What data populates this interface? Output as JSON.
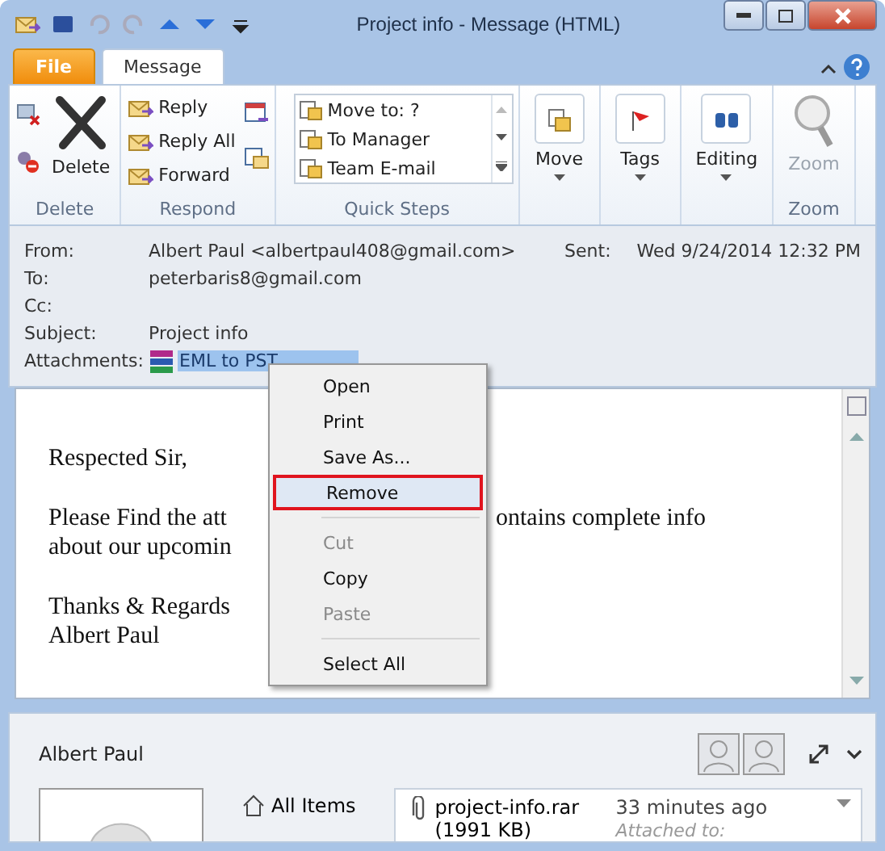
{
  "window": {
    "title": "Project info  -  Message (HTML)"
  },
  "tabs": [
    {
      "label": "File",
      "kind": "file",
      "selected": false
    },
    {
      "label": "Message",
      "kind": "tab",
      "selected": true
    }
  ],
  "ribbon": {
    "groups": [
      {
        "label": "Delete",
        "kind": "delete",
        "big": "Delete"
      },
      {
        "label": "Respond",
        "kind": "respond",
        "items": [
          "Reply",
          "Reply All",
          "Forward"
        ]
      },
      {
        "label": "Quick Steps",
        "kind": "quick",
        "items": [
          "Move to: ?",
          "To Manager",
          "Team E-mail"
        ]
      },
      {
        "kind": "move",
        "big": "Move",
        "disabled": false
      },
      {
        "kind": "tags",
        "big": "Tags",
        "disabled": false
      },
      {
        "kind": "editing",
        "big": "Editing",
        "disabled": false
      },
      {
        "label": "Zoom",
        "kind": "zoom",
        "big": "Zoom",
        "disabled": true
      }
    ]
  },
  "header": {
    "fields": [
      {
        "label": "From:",
        "value": "Albert Paul <albertpaul408@gmail.com>"
      },
      {
        "label": "To:",
        "value": "peterbaris8@gmail.com"
      },
      {
        "label": "Cc:"
      },
      {
        "label": "Subject:",
        "value": "Project info"
      }
    ],
    "sent": {
      "label": "Sent:",
      "value": "Wed 9/24/2014 12:32 PM"
    },
    "attachments": {
      "label": "Attachments:",
      "name": "EML to PST",
      "selected": true
    }
  },
  "body": {
    "paragraphs": [
      [
        {
          "left": "Respected Sir,"
        }
      ],
      [
        {
          "left": "Please Find the att",
          "right": "ontains complete info"
        },
        {
          "left": "about our upcomin"
        }
      ],
      [
        {
          "left": "Thanks & Regards"
        },
        {
          "left": "Albert Paul"
        }
      ]
    ]
  },
  "context_menu": {
    "items": [
      {
        "kind": "item",
        "label": "Open",
        "disabled": false,
        "selected": false
      },
      {
        "kind": "item",
        "label": "Print",
        "disabled": false,
        "selected": false
      },
      {
        "kind": "item",
        "label": "Save As...",
        "disabled": false,
        "selected": false
      },
      {
        "kind": "item",
        "label": "Remove",
        "disabled": false,
        "selected": true
      },
      {
        "kind": "separator"
      },
      {
        "kind": "item",
        "label": "Cut",
        "disabled": true,
        "selected": false
      },
      {
        "kind": "item",
        "label": "Copy",
        "disabled": false,
        "selected": false
      },
      {
        "kind": "item",
        "label": "Paste",
        "disabled": true,
        "selected": false
      },
      {
        "kind": "separator"
      },
      {
        "kind": "item",
        "label": "Select All",
        "disabled": false,
        "selected": false
      }
    ]
  },
  "people_pane": {
    "name": "Albert Paul",
    "nav": [
      "All Items"
    ],
    "item": {
      "name": "project-info.rar (1991 KB)",
      "time": "33 minutes ago",
      "note": "Attached to:"
    }
  }
}
